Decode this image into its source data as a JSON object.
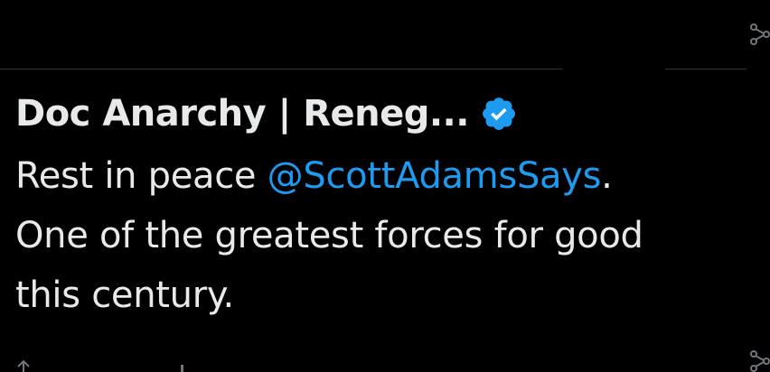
{
  "tweet": {
    "author": {
      "display_name": "Doc Anarchy | Reneg...",
      "verified_icon": "verified-badge-icon"
    },
    "text": {
      "part1": "Rest in peace ",
      "mention": "@ScottAdamsSays",
      "part2": ".",
      "line2": "One of the greatest forces for good",
      "line3": "this century."
    }
  },
  "colors": {
    "background": "#000000",
    "text": "#e7e9ea",
    "accent": "#1d9bf0",
    "divider": "#2f3336",
    "muted_icon": "#71767b"
  },
  "icons": {
    "top_right": "share-node-icon",
    "bottom_right": "share-node-icon",
    "bottom_left": "retweet-icon"
  }
}
